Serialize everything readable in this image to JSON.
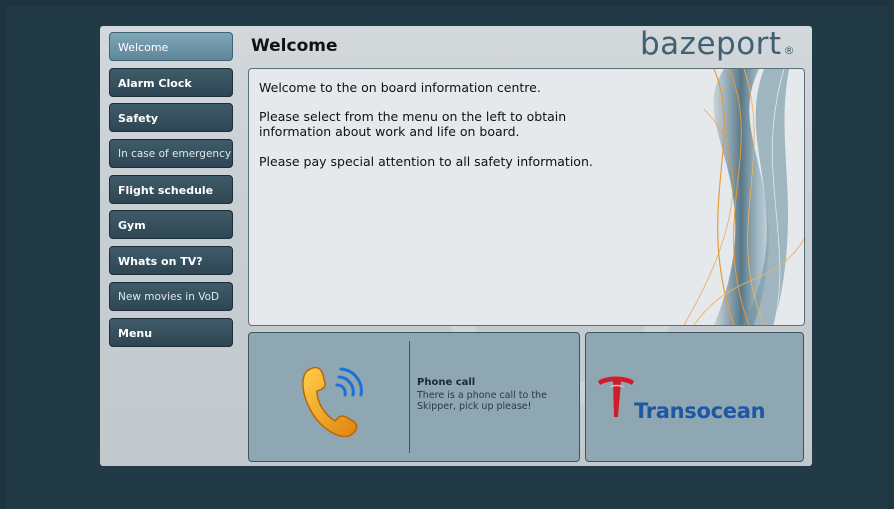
{
  "header": {
    "title": "Welcome",
    "logo_text": "bazeport",
    "logo_reg": "®"
  },
  "menu": {
    "items": [
      {
        "label": "Welcome",
        "active": true
      },
      {
        "label": "Alarm Clock"
      },
      {
        "label": "Safety"
      },
      {
        "label": "In case of emergency"
      },
      {
        "label": "Flight schedule"
      },
      {
        "label": "Gym"
      },
      {
        "label": "Whats on TV?"
      },
      {
        "label": "New movies in VoD"
      },
      {
        "label": "Menu"
      }
    ]
  },
  "content": {
    "line1": "Welcome to the on board information centre.",
    "line2": "Please select from the menu on the left to obtain information about work and life on board.",
    "line3": "Please pay special attention to all safety information."
  },
  "notification": {
    "title": "Phone call",
    "text": "There is a phone call to the Skipper, pick up please!",
    "icon": "phone-icon"
  },
  "brand": {
    "name": "Transocean",
    "icon": "transocean-logo-icon"
  },
  "colors": {
    "background": "#1f3441",
    "menu_button": "#2e4653",
    "menu_active": "#6e96a8",
    "brand_blue": "#1e57a3",
    "brand_red": "#d21c2a",
    "accent_orange": "#e89a3a"
  }
}
